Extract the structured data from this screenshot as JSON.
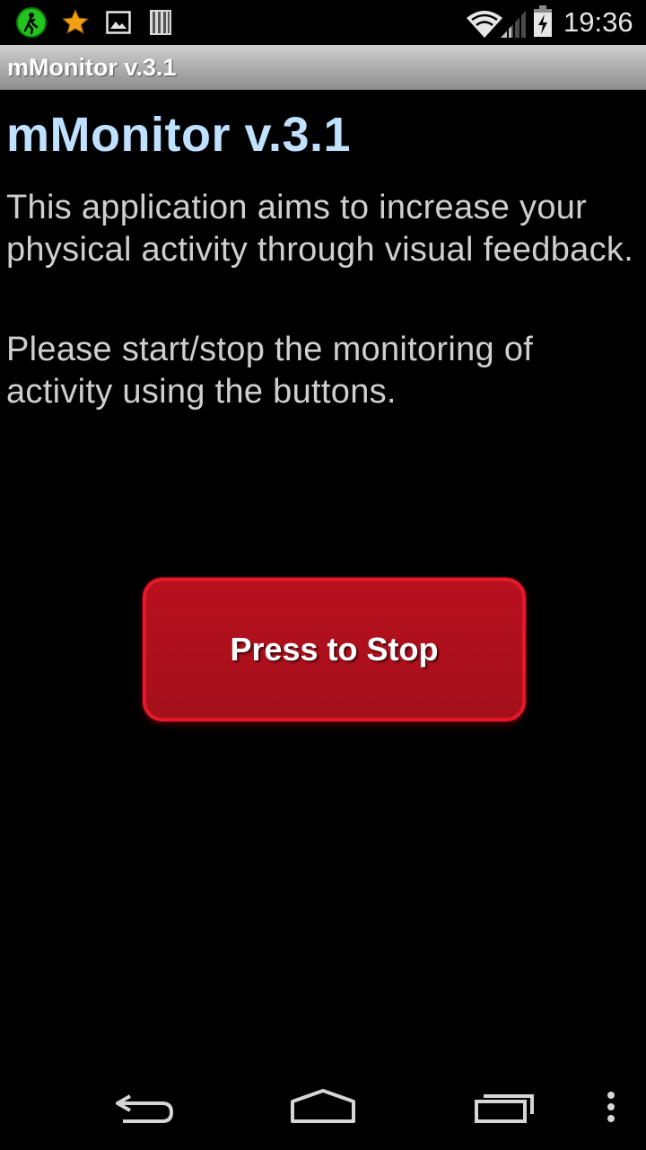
{
  "status_bar": {
    "time": "19:36",
    "icons": [
      "app-running-icon",
      "star-icon",
      "image-icon",
      "sd-card-icon",
      "wifi-icon",
      "signal-icon",
      "battery-charging-icon"
    ]
  },
  "title_bar": {
    "title": "mMonitor v.3.1"
  },
  "main": {
    "heading": "mMonitor v.3.1",
    "description": "This application aims to increase your physical activity through visual feedback.",
    "instruction": "Please start/stop the monitoring of activity using the buttons.",
    "stop_button_label": "Press to Stop"
  },
  "nav_bar": {
    "icons": [
      "back-icon",
      "home-icon",
      "recent-apps-icon",
      "overflow-menu-icon"
    ]
  },
  "colors": {
    "heading": "#bfe0ff",
    "body_text": "#cfcfcf",
    "button_fill": "#ae111d",
    "button_border": "#e3192a",
    "background": "#000000"
  }
}
